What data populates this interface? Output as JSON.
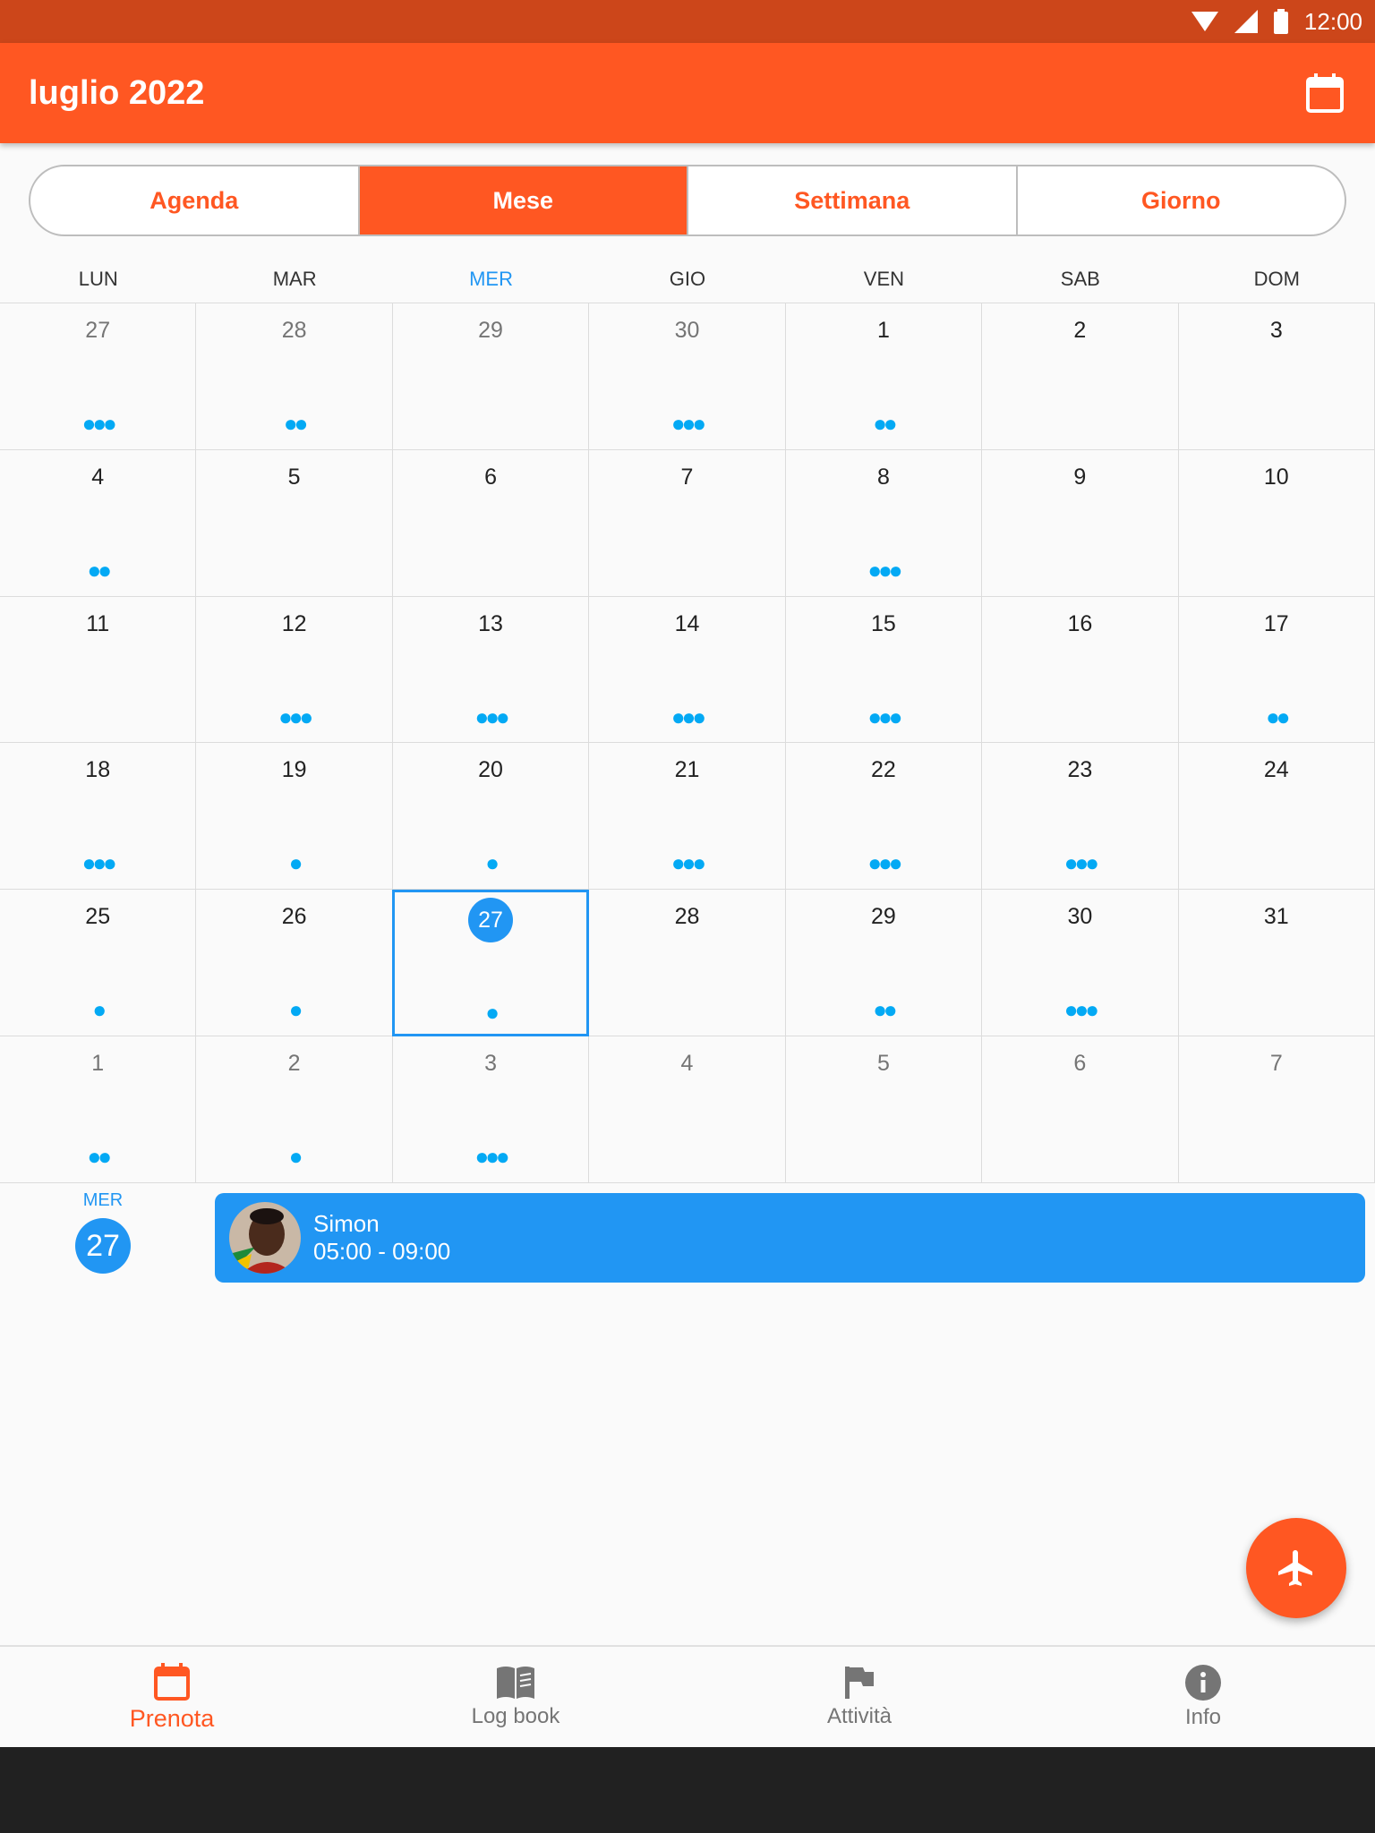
{
  "status_bar": {
    "time": "12:00"
  },
  "app_bar": {
    "title": "luglio 2022",
    "calendar_icon": "calendar-icon"
  },
  "segments": [
    {
      "label": "Agenda",
      "active": false
    },
    {
      "label": "Mese",
      "active": true
    },
    {
      "label": "Settimana",
      "active": false
    },
    {
      "label": "Giorno",
      "active": false
    }
  ],
  "weekdays": [
    "LUN",
    "MAR",
    "MER",
    "GIO",
    "VEN",
    "SAB",
    "DOM"
  ],
  "today_weekday_index": 2,
  "calendar": {
    "weeks": [
      [
        {
          "day": "27",
          "out": true,
          "dots": 3
        },
        {
          "day": "28",
          "out": true,
          "dots": 2
        },
        {
          "day": "29",
          "out": true,
          "dots": 0
        },
        {
          "day": "30",
          "out": true,
          "dots": 3
        },
        {
          "day": "1",
          "dots": 2
        },
        {
          "day": "2",
          "dots": 0
        },
        {
          "day": "3",
          "dots": 0
        }
      ],
      [
        {
          "day": "4",
          "dots": 2
        },
        {
          "day": "5",
          "dots": 0
        },
        {
          "day": "6",
          "dots": 0
        },
        {
          "day": "7",
          "dots": 0
        },
        {
          "day": "8",
          "dots": 3
        },
        {
          "day": "9",
          "dots": 0
        },
        {
          "day": "10",
          "dots": 0
        }
      ],
      [
        {
          "day": "11",
          "dots": 0
        },
        {
          "day": "12",
          "dots": 3
        },
        {
          "day": "13",
          "dots": 3
        },
        {
          "day": "14",
          "dots": 3
        },
        {
          "day": "15",
          "dots": 3
        },
        {
          "day": "16",
          "dots": 0
        },
        {
          "day": "17",
          "dots": 2
        }
      ],
      [
        {
          "day": "18",
          "dots": 3
        },
        {
          "day": "19",
          "dots": 1
        },
        {
          "day": "20",
          "dots": 1
        },
        {
          "day": "21",
          "dots": 3
        },
        {
          "day": "22",
          "dots": 3
        },
        {
          "day": "23",
          "dots": 3
        },
        {
          "day": "24",
          "dots": 0
        }
      ],
      [
        {
          "day": "25",
          "dots": 1
        },
        {
          "day": "26",
          "dots": 1
        },
        {
          "day": "27",
          "dots": 1,
          "selected": true
        },
        {
          "day": "28",
          "dots": 0
        },
        {
          "day": "29",
          "dots": 2
        },
        {
          "day": "30",
          "dots": 3
        },
        {
          "day": "31",
          "dots": 0
        }
      ],
      [
        {
          "day": "1",
          "out": true,
          "dots": 2
        },
        {
          "day": "2",
          "out": true,
          "dots": 1
        },
        {
          "day": "3",
          "out": true,
          "dots": 3
        },
        {
          "day": "4",
          "out": true,
          "dots": 0
        },
        {
          "day": "5",
          "out": true,
          "dots": 0
        },
        {
          "day": "6",
          "out": true,
          "dots": 0
        },
        {
          "day": "7",
          "out": true,
          "dots": 0
        }
      ]
    ]
  },
  "selected_day": {
    "weekday": "MER",
    "day": "27"
  },
  "event": {
    "name": "Simon",
    "time": "05:00 - 09:00"
  },
  "fab": {
    "icon": "airplane-icon"
  },
  "bottom_nav": [
    {
      "label": "Prenota",
      "icon": "calendar-icon",
      "active": true
    },
    {
      "label": "Log book",
      "icon": "book-icon",
      "active": false
    },
    {
      "label": "Attività",
      "icon": "flag-icon",
      "active": false
    },
    {
      "label": "Info",
      "icon": "info-icon",
      "active": false
    }
  ],
  "colors": {
    "accent": "#ff5722",
    "status_bar": "#cc461a",
    "blue": "#2196f3",
    "dot": "#03a9f4"
  }
}
